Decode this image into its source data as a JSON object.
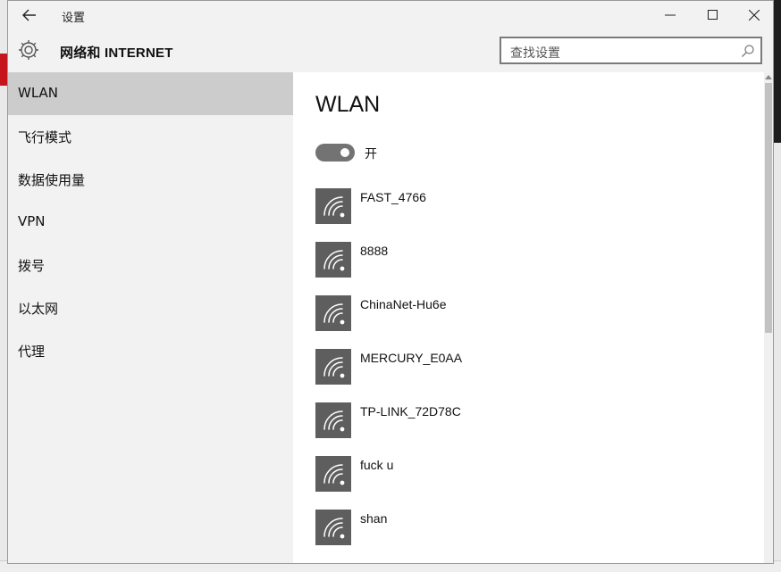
{
  "window": {
    "title": "设置",
    "back_icon": "arrow-left-icon",
    "controls": [
      "minimize-icon",
      "maximize-icon",
      "close-icon"
    ]
  },
  "header": {
    "icon": "gear-icon",
    "title": "网络和 INTERNET",
    "search_placeholder": "查找设置",
    "search_icon": "search-icon"
  },
  "sidebar": {
    "items": [
      {
        "label": "WLAN",
        "selected": true
      },
      {
        "label": "飞行模式",
        "selected": false
      },
      {
        "label": "数据使用量",
        "selected": false
      },
      {
        "label": "VPN",
        "selected": false
      },
      {
        "label": "拨号",
        "selected": false
      },
      {
        "label": "以太网",
        "selected": false
      },
      {
        "label": "代理",
        "selected": false
      }
    ]
  },
  "content": {
    "title": "WLAN",
    "wifi_toggle": {
      "label": "开",
      "on": true
    },
    "networks": [
      {
        "name": "FAST_4766",
        "icon": "wifi-icon"
      },
      {
        "name": "8888",
        "icon": "wifi-icon"
      },
      {
        "name": "ChinaNet-Hu6e",
        "icon": "wifi-icon"
      },
      {
        "name": "MERCURY_E0AA",
        "icon": "wifi-icon"
      },
      {
        "name": "TP-LINK_72D78C",
        "icon": "wifi-icon"
      },
      {
        "name": "fuck u",
        "icon": "wifi-icon"
      },
      {
        "name": "shan",
        "icon": "wifi-icon"
      }
    ]
  },
  "colors": {
    "window_bg": "#f2f2f2",
    "selected_nav": "#cccccc",
    "toggle_on": "#737373",
    "wifi_tile": "#5e5e5e"
  }
}
